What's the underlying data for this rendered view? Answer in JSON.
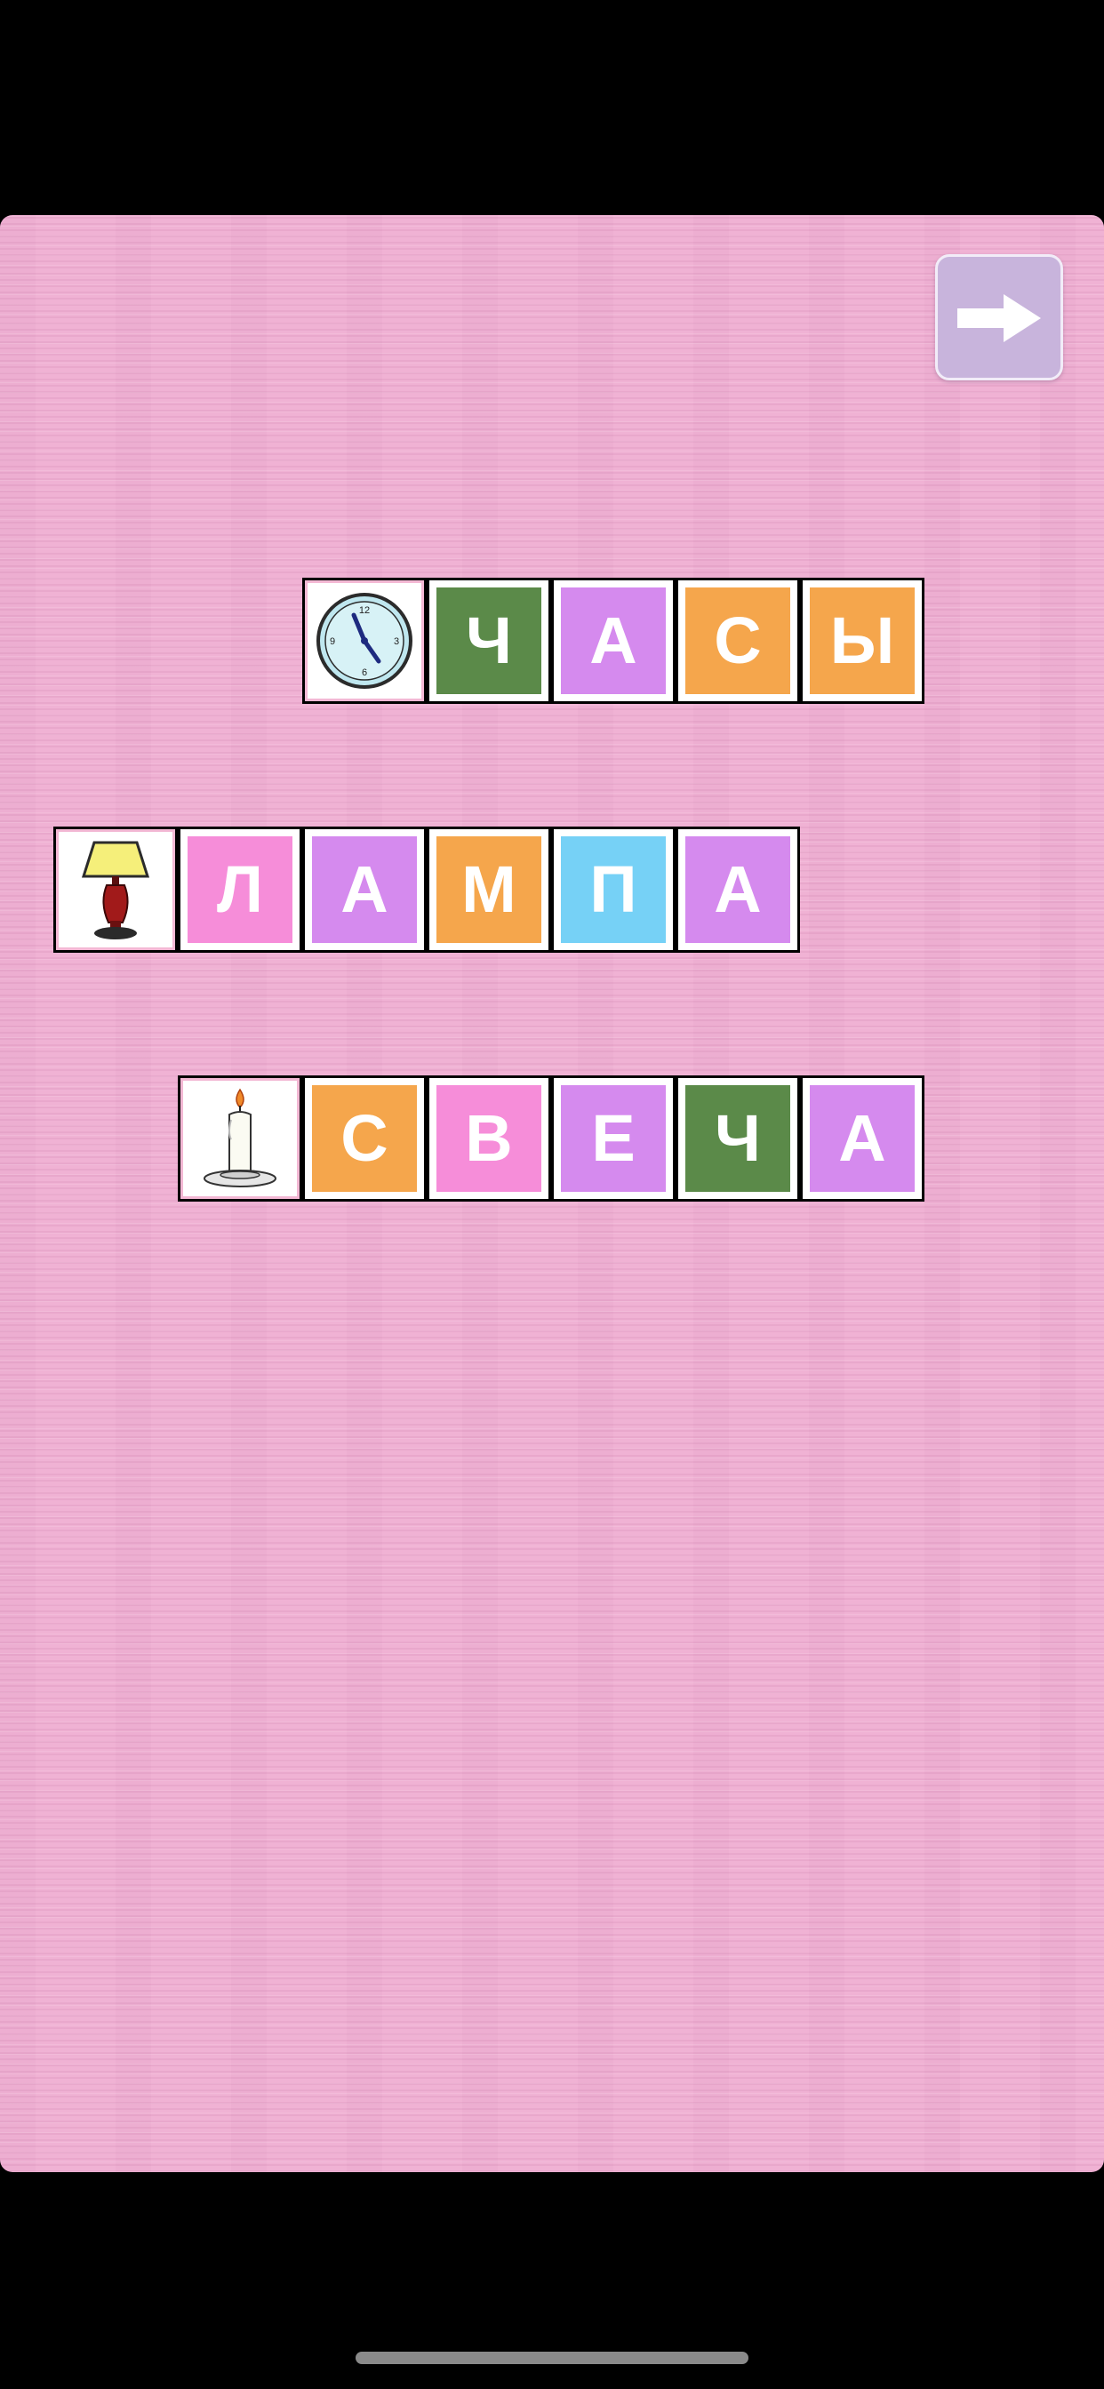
{
  "game": {
    "next_icon": "right-arrow-icon",
    "words": [
      {
        "picture": "clock",
        "letters": [
          {
            "char": "Ч",
            "color": "#5b8a49"
          },
          {
            "char": "А",
            "color": "#d58aee"
          },
          {
            "char": "С",
            "color": "#f5a64c"
          },
          {
            "char": "Ы",
            "color": "#f5a64c"
          }
        ]
      },
      {
        "picture": "lamp",
        "letters": [
          {
            "char": "Л",
            "color": "#f68dd9"
          },
          {
            "char": "А",
            "color": "#d58aee"
          },
          {
            "char": "М",
            "color": "#f5a64c"
          },
          {
            "char": "П",
            "color": "#76d1f6"
          },
          {
            "char": "А",
            "color": "#d58aee"
          }
        ]
      },
      {
        "picture": "candle",
        "letters": [
          {
            "char": "С",
            "color": "#f5a64c"
          },
          {
            "char": "В",
            "color": "#f68dd9"
          },
          {
            "char": "Е",
            "color": "#d58aee"
          },
          {
            "char": "Ч",
            "color": "#5b8a49"
          },
          {
            "char": "А",
            "color": "#d58aee"
          }
        ]
      }
    ]
  }
}
